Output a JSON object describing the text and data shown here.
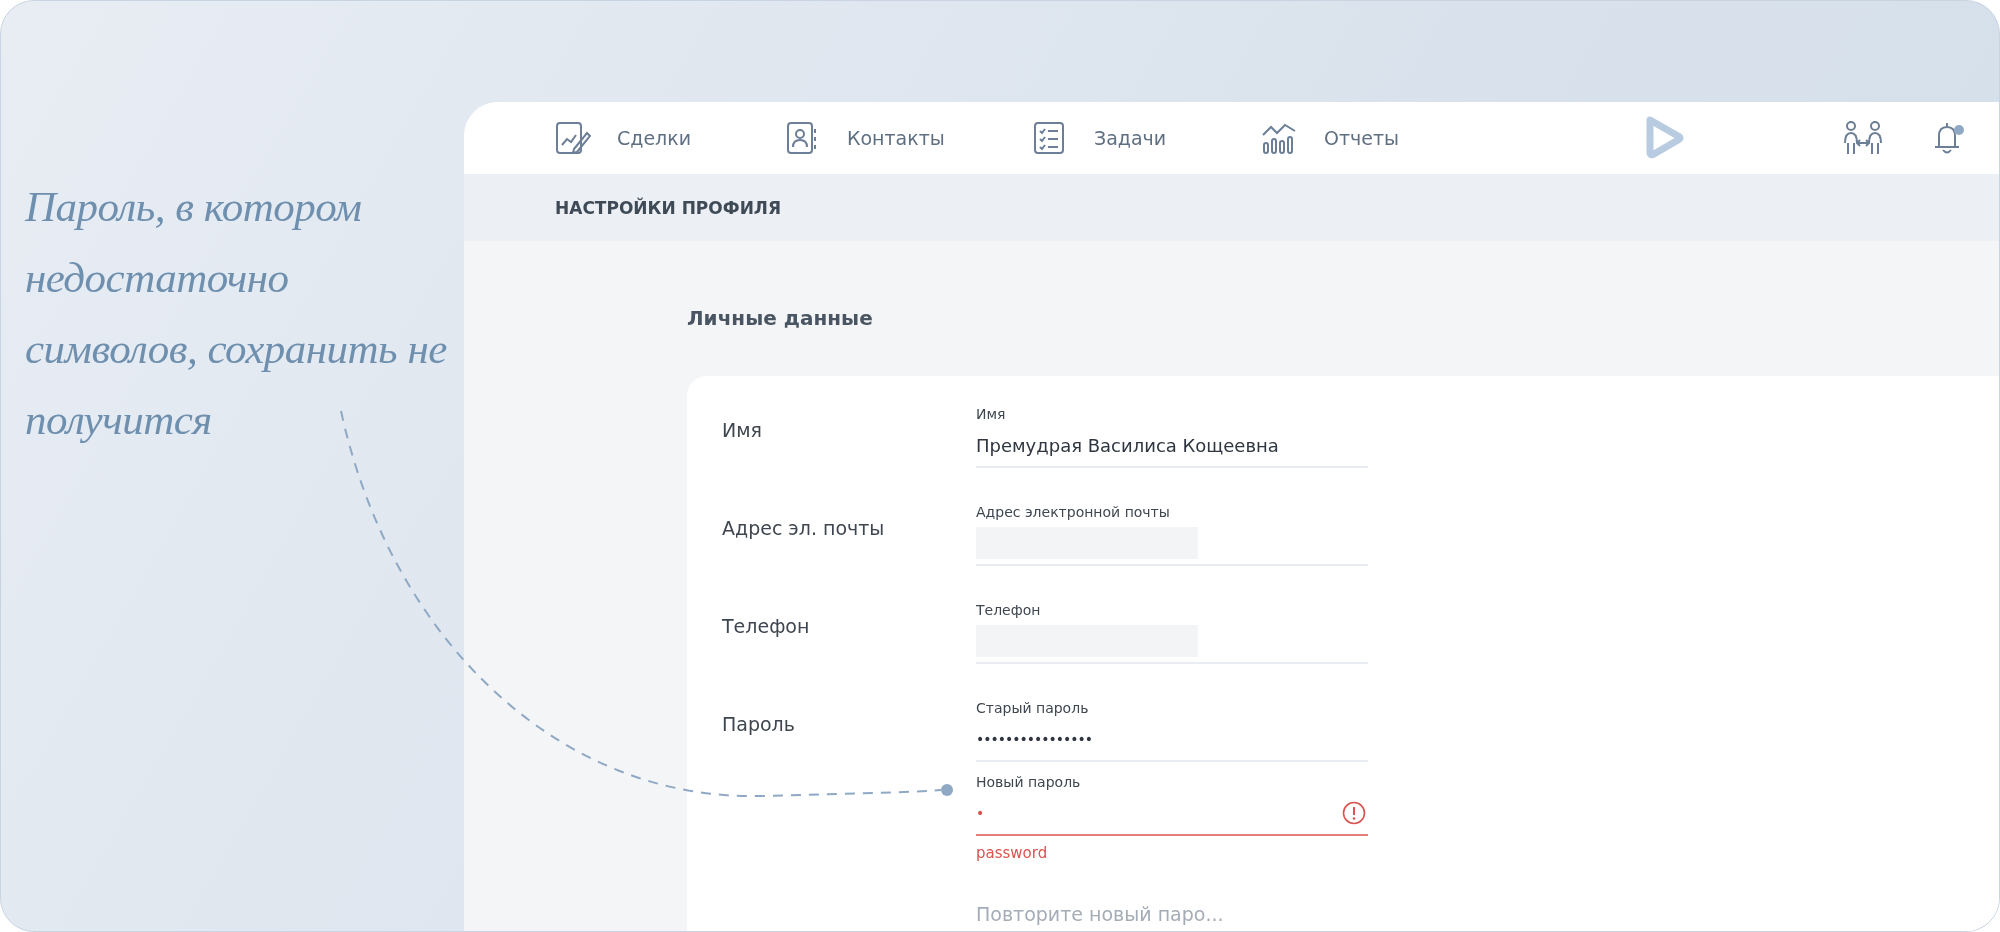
{
  "annotation": {
    "text": "Пароль, в котором недостаточно символов, сохранить не получится"
  },
  "nav": {
    "items": [
      {
        "label": "Сделки",
        "kind": "document"
      },
      {
        "label": "Контакты",
        "kind": "contact"
      },
      {
        "label": "Задачи",
        "kind": "checklist"
      },
      {
        "label": "Отчеты",
        "kind": "chart"
      }
    ],
    "notification_dot": true
  },
  "page_title": "НАСТРОЙКИ ПРОФИЛЯ",
  "section_title": "Личные данные",
  "form": {
    "rows": [
      {
        "label": "Имя",
        "fields": [
          {
            "kind": "text",
            "label": "Имя",
            "value": "Премудрая Василиса Кощеевна"
          }
        ]
      },
      {
        "label": "Адрес эл. почты",
        "fields": [
          {
            "kind": "redacted",
            "label": "Адрес электронной почты"
          }
        ]
      },
      {
        "label": "Телефон",
        "fields": [
          {
            "kind": "redacted",
            "label": "Телефон"
          }
        ]
      },
      {
        "label": "Пароль",
        "fields": [
          {
            "kind": "password",
            "label": "Старый пароль",
            "value": "••••••••••••••••",
            "error": false
          },
          {
            "kind": "password",
            "label": "Новый пароль",
            "value": "•",
            "error": true,
            "error_text": "password"
          },
          {
            "kind": "empty",
            "placeholder": "Повторите новый паро..."
          }
        ]
      }
    ]
  }
}
